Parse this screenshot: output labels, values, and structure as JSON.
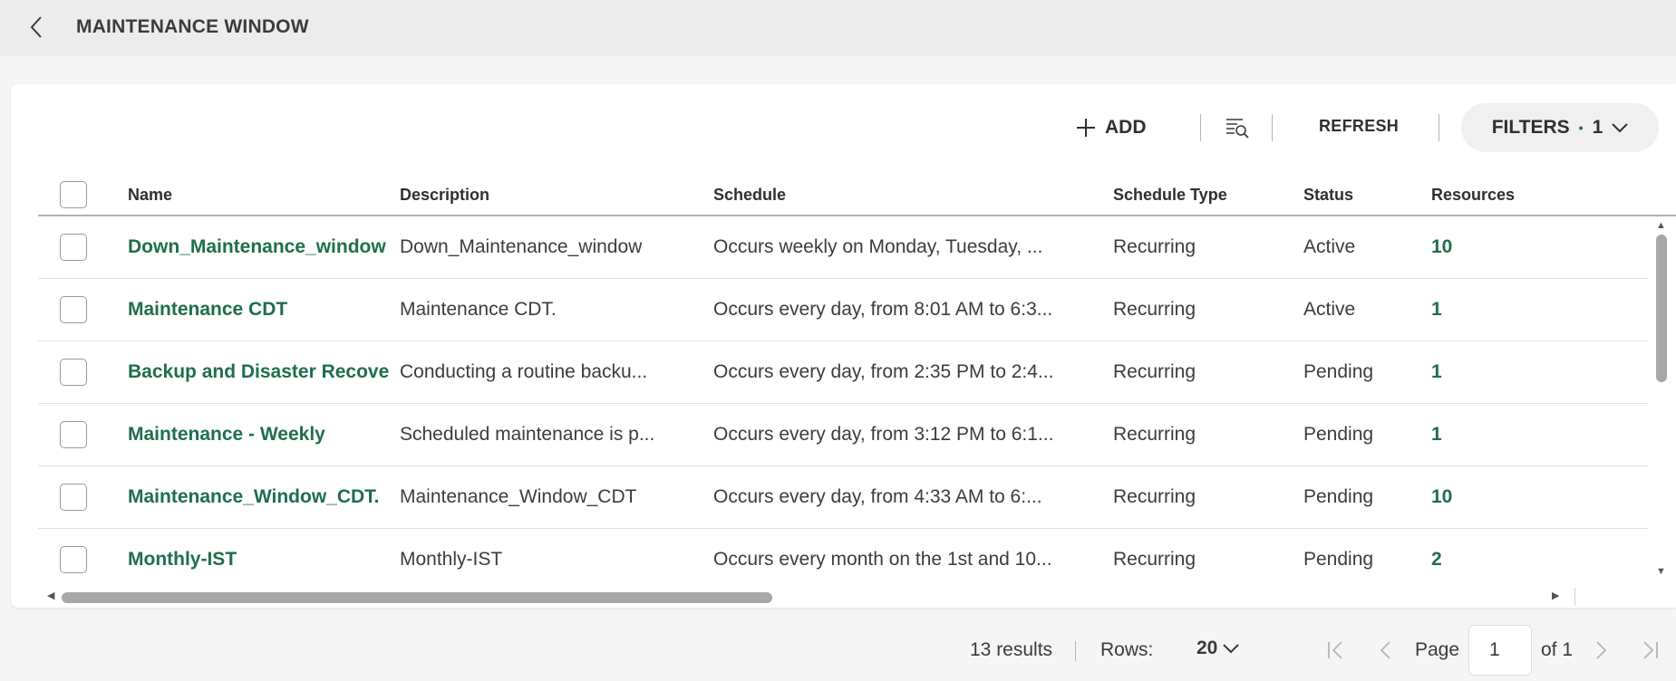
{
  "header": {
    "title": "MAINTENANCE WINDOW"
  },
  "toolbar": {
    "add_label": "ADD",
    "refresh_label": "REFRESH",
    "filters_label": "FILTERS",
    "filters_dot": "•",
    "filters_count": "1"
  },
  "table": {
    "columns": [
      "Name",
      "Description",
      "Schedule",
      "Schedule Type",
      "Status",
      "Resources"
    ],
    "rows": [
      {
        "name": "Down_Maintenance_window",
        "description": "Down_Maintenance_window",
        "schedule": "Occurs weekly on Monday, Tuesday, ...",
        "type": "Recurring",
        "status": "Active",
        "resources": "10"
      },
      {
        "name": "Maintenance CDT",
        "description": "Maintenance CDT.",
        "schedule": "Occurs every day, from 8:01 AM to 6:3...",
        "type": "Recurring",
        "status": "Active",
        "resources": "1"
      },
      {
        "name": "Backup and Disaster Recove",
        "description": "Conducting a routine backu...",
        "schedule": "Occurs every day, from 2:35 PM to 2:4...",
        "type": "Recurring",
        "status": "Pending",
        "resources": "1"
      },
      {
        "name": "Maintenance - Weekly",
        "description": "Scheduled maintenance is p...",
        "schedule": "Occurs every day, from 3:12 PM to 6:1...",
        "type": "Recurring",
        "status": "Pending",
        "resources": "1"
      },
      {
        "name": "Maintenance_Window_CDT.",
        "description": "Maintenance_Window_CDT",
        "schedule": "Occurs every day, from 4:33 AM to 6:...",
        "type": "Recurring",
        "status": "Pending",
        "resources": "10"
      },
      {
        "name": "Monthly-IST",
        "description": "Monthly-IST",
        "schedule": "Occurs every month on the 1st and 10...",
        "type": "Recurring",
        "status": "Pending",
        "resources": "2"
      }
    ]
  },
  "footer": {
    "results": "13 results",
    "rows_label": "Rows:",
    "rows_value": "20",
    "page_label": "Page",
    "page_value": "1",
    "page_of": "of 1"
  },
  "icons": {
    "back": "chevron-left-icon",
    "add": "plus-icon",
    "search": "list-search-icon",
    "filters": "chevron-down-icon"
  },
  "colors": {
    "accent": "#1f6e4c",
    "header_bg": "#ececec",
    "page_bg": "#f5f5f5"
  }
}
